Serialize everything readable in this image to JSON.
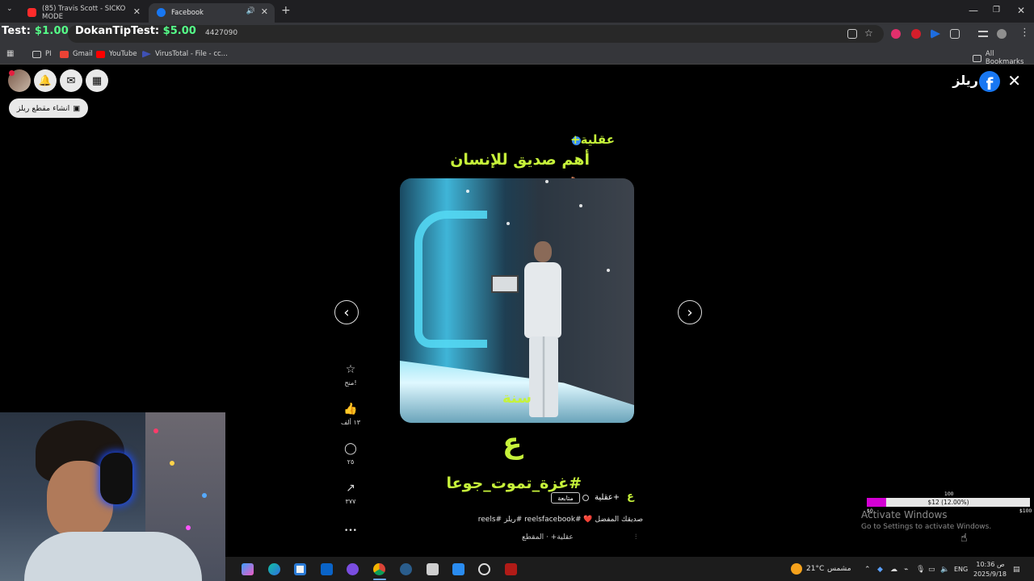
{
  "browser": {
    "tabs": [
      {
        "label": "(85) Travis Scott - SICKO MODE",
        "favicon_color": "#ff2b2b"
      },
      {
        "label": "Facebook",
        "favicon_color": "#1877f2"
      }
    ],
    "new_tab": "+",
    "url_visible": "4427090",
    "bookmarks": [
      {
        "label": "PI"
      },
      {
        "label": "Gmail"
      },
      {
        "label": "YouTube"
      },
      {
        "label": "VirusTotal - File - cc..."
      }
    ],
    "all_bookmarks": "All Bookmarks"
  },
  "overlay": {
    "test_label": "Test: ",
    "test_amount": "$1.00",
    "dokan_label": "DokanTipTest: ",
    "dokan_amount": "$5.00"
  },
  "facebook": {
    "create_reel": "انشاء مقطع ريلز",
    "reels_title": "ريلز",
    "logo_letter": "f"
  },
  "reel": {
    "brand": "عقلية+",
    "headline": "أهم صديق للإنسان 🛏️",
    "video_caption": "سنة",
    "logo_glyph": "ع",
    "hashtag": "#غزة_تموت_جوعا",
    "author_name": "عقلية+",
    "follow": "متابعة",
    "description": "صديقك المفضل ❤️ #reelsfacebook #ريلز #reels",
    "audio": "عقلية+ · المقطع",
    "actions": [
      {
        "icon": "☆",
        "label": "منح!"
      },
      {
        "icon": "👍",
        "label": "١٣ ألف"
      },
      {
        "icon": "◯",
        "label": "٢٥"
      },
      {
        "icon": "↗",
        "label": "٣٧٧"
      },
      {
        "icon": "•••",
        "label": ""
      }
    ]
  },
  "goal": {
    "top_label": "100",
    "text": "$12 (12.00%)",
    "progress": 0.12,
    "min_label": "$0",
    "max_label": "$100"
  },
  "windows": {
    "activate_title": "Activate Windows",
    "activate_sub": "Go to Settings to activate Windows.",
    "weather_temp": "21°C",
    "weather_desc": "مشمس",
    "lang": "ENG",
    "time": "10:36 ص",
    "date": "2025/9/18"
  },
  "colors": {
    "accent_green": "#c6f23a",
    "facebook_blue": "#1877f2",
    "goal_magenta": "#d400d4"
  }
}
